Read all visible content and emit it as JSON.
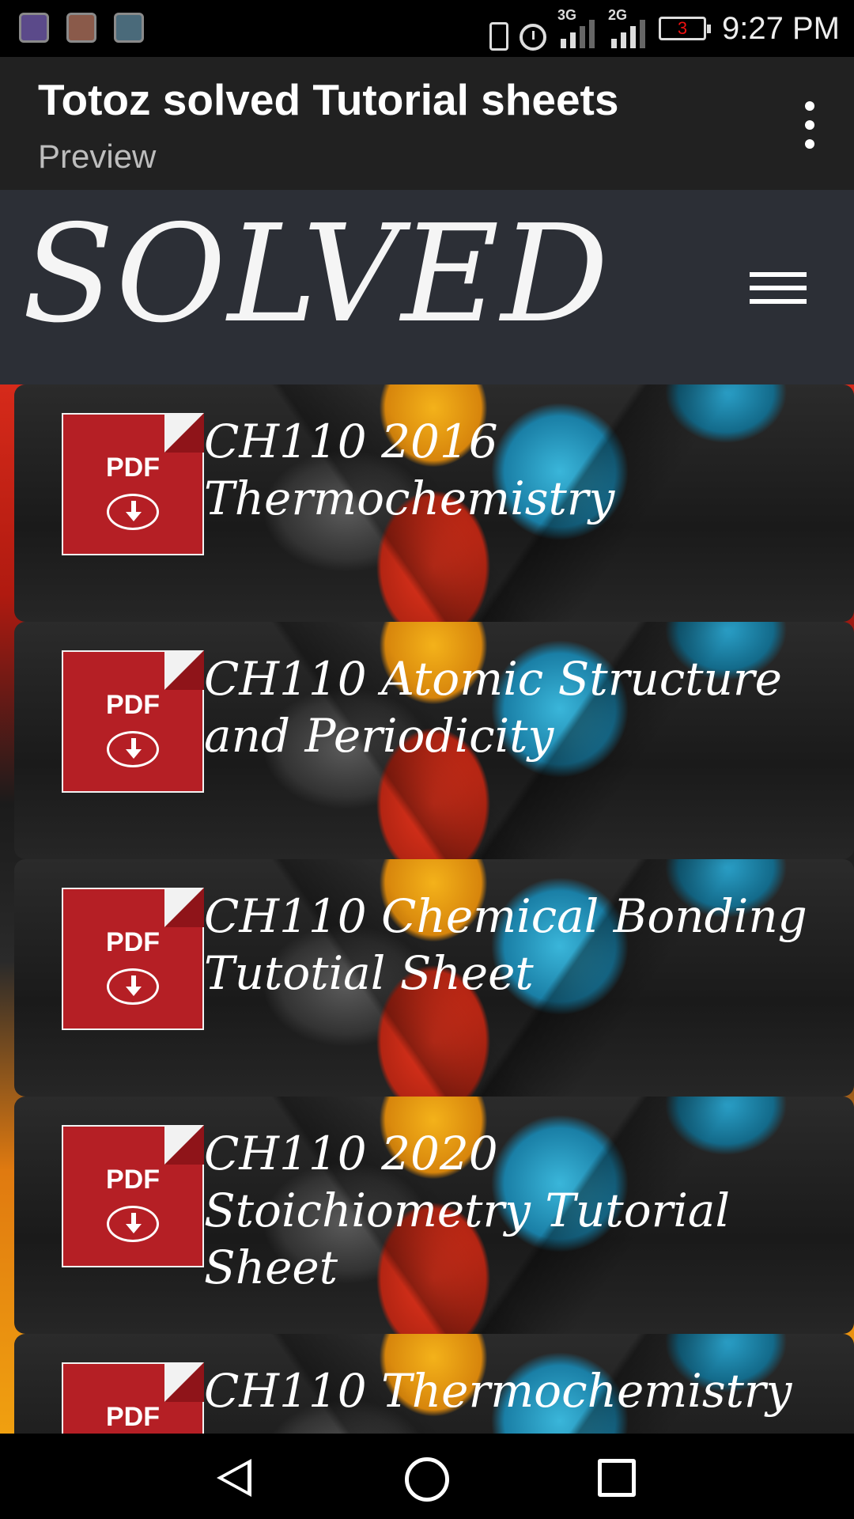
{
  "status_bar": {
    "network_1": "3G",
    "network_2": "2G",
    "battery_level": "3",
    "time": "9:27 PM",
    "notification_icons": [
      "cast-icon",
      "clipboard-icon",
      "gallery-icon"
    ]
  },
  "app_bar": {
    "title": "Totoz solved Tutorial sheets",
    "subtitle": "Preview"
  },
  "site": {
    "logo_text": "SOLVED"
  },
  "documents": [
    {
      "pdf_label": "PDF",
      "title": "CH110 2016 Thermochemistry"
    },
    {
      "pdf_label": "PDF",
      "title": "CH110 Atomic Structure and Periodicity"
    },
    {
      "pdf_label": "PDF",
      "title": "CH110 Chemical Bonding Tutotial Sheet"
    },
    {
      "pdf_label": "PDF",
      "title": "CH110 2020 Stoichiometry Tutorial Sheet"
    },
    {
      "pdf_label": "PDF",
      "title": "CH110 Thermochemistry"
    }
  ],
  "colors": {
    "app_bar_bg": "#212121",
    "header_bg": "#2c2f36",
    "pdf_red": "#b51f25"
  }
}
